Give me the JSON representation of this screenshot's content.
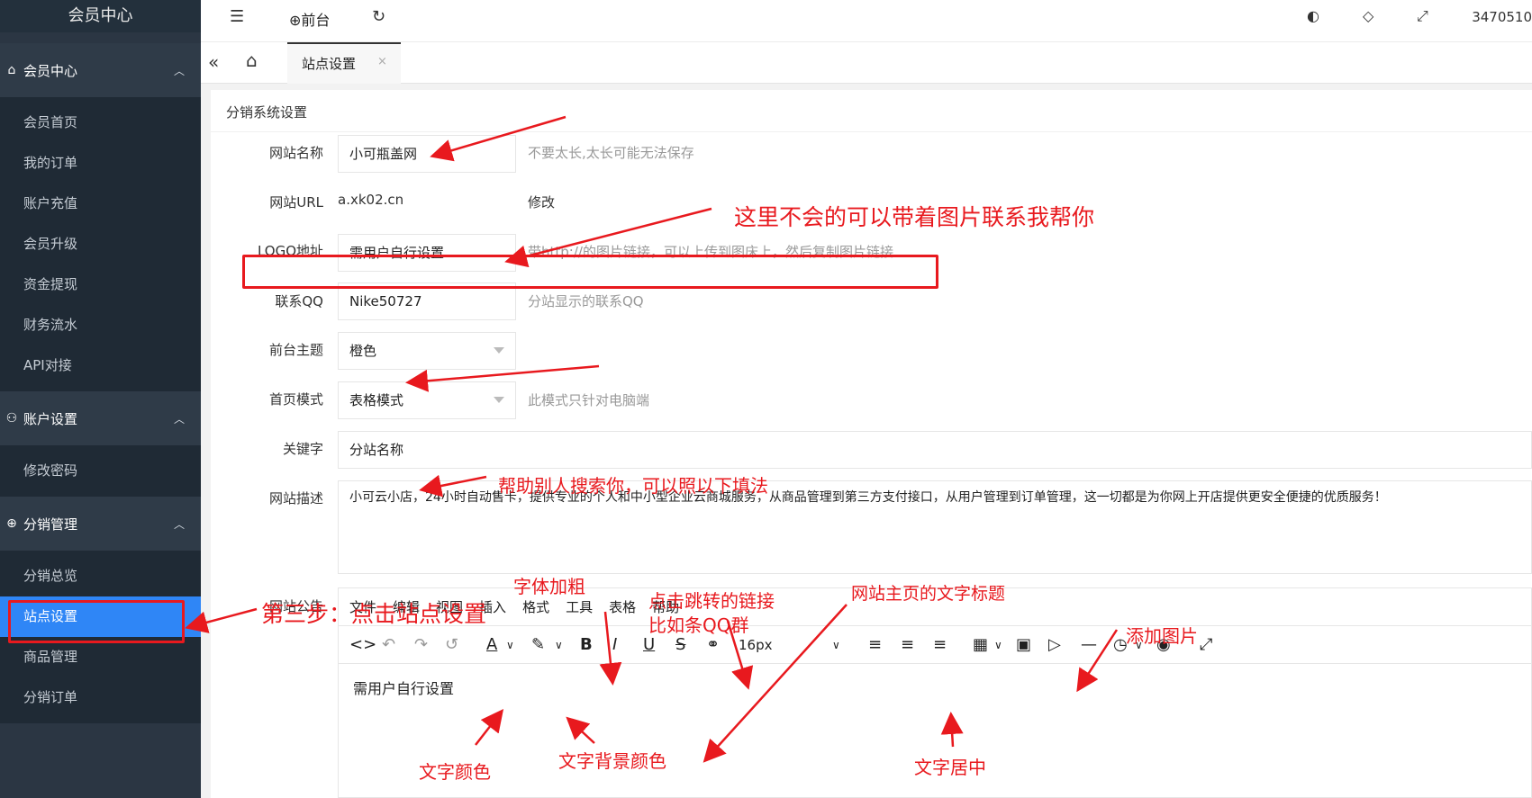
{
  "sidebar": {
    "brand": "会员中心",
    "groups": [
      {
        "label": "会员中心",
        "items": [
          "会员首页",
          "我的订单",
          "账户充值",
          "会员升级",
          "资金提现",
          "财务流水",
          "API对接"
        ]
      },
      {
        "label": "账户设置",
        "items": [
          "修改密码"
        ]
      },
      {
        "label": "分销管理",
        "items": [
          "分销总览",
          "站点设置",
          "商品管理",
          "分销订单"
        ]
      }
    ],
    "active_item": "站点设置"
  },
  "topbar": {
    "front_label": "前台",
    "user": "3470510"
  },
  "tabs": {
    "active_label": "站点设置",
    "close": "×"
  },
  "form": {
    "title": "分销系统设置",
    "site_name": {
      "label": "网站名称",
      "value": "小可瓶盖网",
      "hint": "不要太长,太长可能无法保存"
    },
    "site_url": {
      "label": "网站URL",
      "value": "a.xk02.cn",
      "action": "修改"
    },
    "logo": {
      "label": "LOGO地址",
      "value": "需用户自行设置",
      "hint": "带http://的图片链接，可以上传到图床上，然后复制图片链接"
    },
    "qq": {
      "label": "联系QQ",
      "value": "Nike50727",
      "hint": "分站显示的联系QQ"
    },
    "theme": {
      "label": "前台主题",
      "value": "橙色"
    },
    "home_mode": {
      "label": "首页模式",
      "value": "表格模式",
      "hint": "此模式只针对电脑端"
    },
    "keywords": {
      "label": "关键字",
      "value": "分站名称"
    },
    "description": {
      "label": "网站描述",
      "value": "小可云小店，24小时自动售卡，提供专业的个人和中小型企业云商城服务，从商品管理到第三方支付接口，从用户管理到订单管理，这一切都是为你网上开店提供更安全便捷的优质服务！"
    },
    "notice": {
      "label": "网站公告"
    }
  },
  "editor": {
    "menu": [
      "文件",
      "编辑",
      "视图",
      "插入",
      "格式",
      "工具",
      "表格",
      "帮助"
    ],
    "font_size": "16px",
    "content": "需用户自行设置"
  },
  "annotations": {
    "logo_help": "这里不会的可以带着图片联系我帮你",
    "keyword_help": "帮助别人搜索你，可以照以下填法",
    "step3": "第三步：点击站点设置",
    "bold": "字体加粗",
    "link_1": "点击跳转的链接",
    "link_2": "比如条QQ群",
    "title": "网站主页的文字标题",
    "image": "添加图片",
    "text_color": "文字颜色",
    "bg_color": "文字背景颜色",
    "center": "文字居中"
  },
  "colors": {
    "sidebar_bg": "#2b3643",
    "active": "#2f86f6",
    "annotation": "#e8191e"
  }
}
